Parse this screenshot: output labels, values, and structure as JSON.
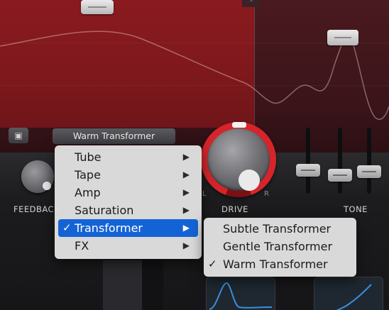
{
  "preset": {
    "name": "Warm Transformer"
  },
  "knobs": {
    "feedback": {
      "label": "FEEDBACK"
    },
    "drive": {
      "label": "DRIVE",
      "left_marker": "L",
      "right_marker": "R"
    },
    "tone": {
      "label": "TONE"
    }
  },
  "context_menu": {
    "items": [
      {
        "label": "Tube",
        "has_submenu": true
      },
      {
        "label": "Tape",
        "has_submenu": true
      },
      {
        "label": "Amp",
        "has_submenu": true
      },
      {
        "label": "Saturation",
        "has_submenu": true
      },
      {
        "label": "Transformer",
        "has_submenu": true,
        "checked": true,
        "highlighted": true
      },
      {
        "label": "FX",
        "has_submenu": true
      }
    ],
    "check_glyph": "✓",
    "arrow_glyph": "▶"
  },
  "submenu": {
    "items": [
      {
        "label": "Subtle Transformer"
      },
      {
        "label": "Gentle Transformer"
      },
      {
        "label": "Warm Transformer",
        "checked": true
      }
    ]
  },
  "icons": {
    "save": "floppy-disk-icon"
  },
  "colors": {
    "accent_red": "#d6242a",
    "menu_highlight": "#1463d6",
    "scope_trace": "#3a8fe0"
  }
}
